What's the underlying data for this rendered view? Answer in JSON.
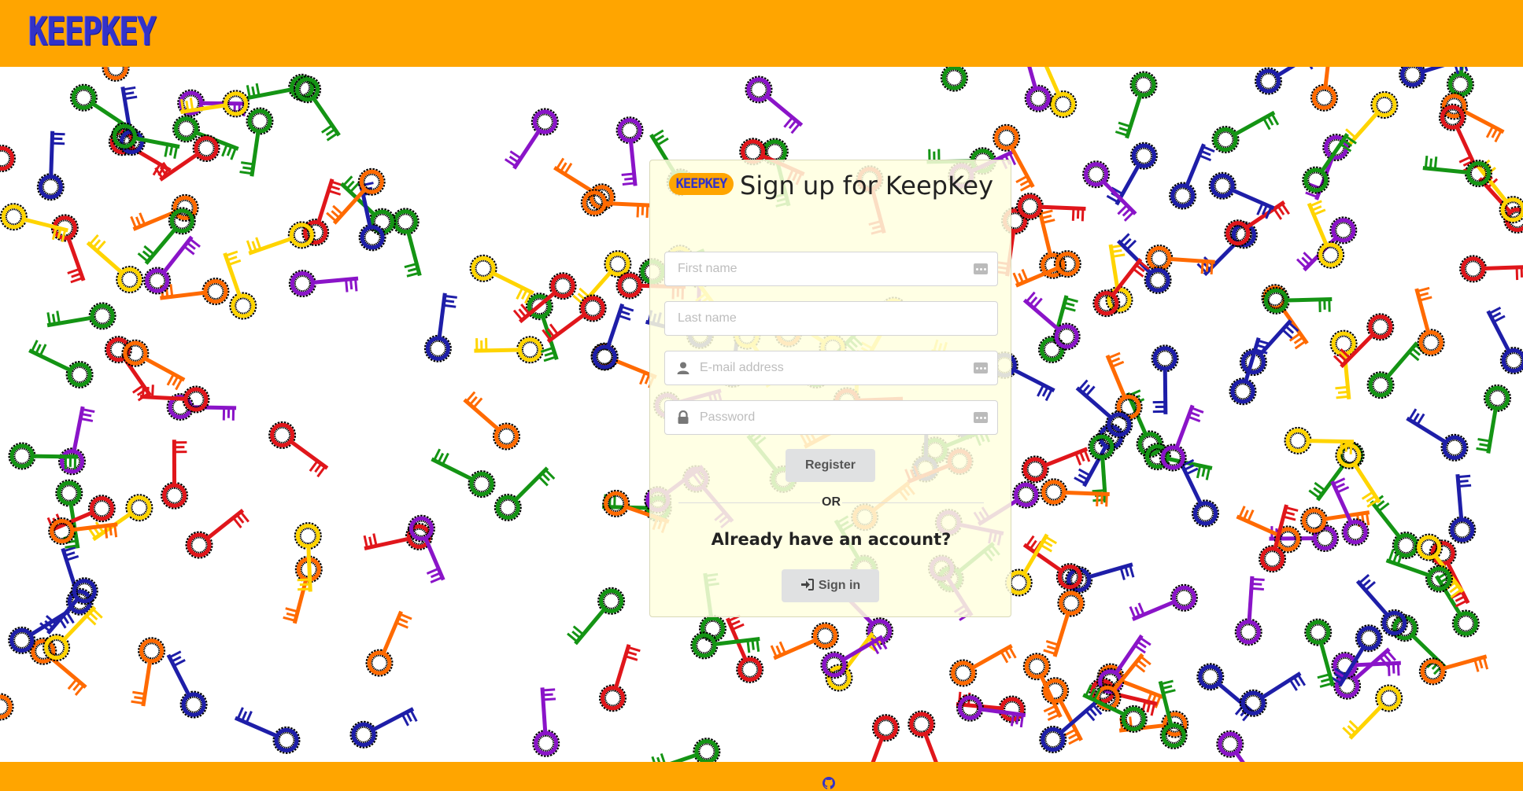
{
  "header": {
    "logo_text": "KEEPKEY"
  },
  "form": {
    "title": "Sign up for KeepKey",
    "mini_logo_text": "KEEPKEY",
    "first_name_placeholder": "First name",
    "last_name_placeholder": "Last name",
    "email_placeholder": "E-mail address",
    "password_placeholder": "Password",
    "register_label": "Register",
    "divider_text": "OR",
    "already_text": "Already have an account?",
    "signin_label": "Sign in"
  },
  "icons": {
    "field_user": "user-icon",
    "field_lock": "lock-icon",
    "password_manager": "password-manager-icon",
    "signin": "sign-in-icon",
    "footer": "github-icon"
  },
  "colors": {
    "brand_orange": "#ffa500",
    "brand_blue": "#3232c8",
    "card_bg": "#ffffe0",
    "key_colors": [
      "#e0161b",
      "#ff6a00",
      "#ffd400",
      "#149414",
      "#1e1ea8",
      "#8a14c8"
    ]
  }
}
